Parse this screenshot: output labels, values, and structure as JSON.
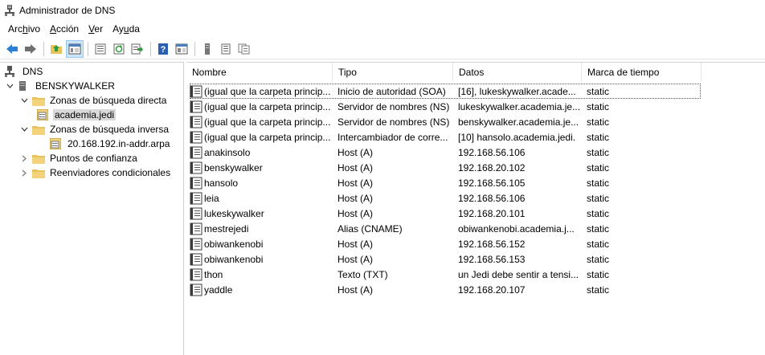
{
  "window": {
    "title": "Administrador de DNS"
  },
  "menubar": {
    "items": [
      {
        "pre": "Arc",
        "ul": "h",
        "post": "ivo"
      },
      {
        "pre": "",
        "ul": "A",
        "post": "cción"
      },
      {
        "pre": "",
        "ul": "V",
        "post": "er"
      },
      {
        "pre": "Ay",
        "ul": "u",
        "post": "da"
      }
    ]
  },
  "toolbar": {
    "buttons": [
      "back-icon",
      "forward-icon",
      "up-folder-icon",
      "show-tree-icon",
      "properties-icon",
      "refresh-icon",
      "export-list-icon",
      "help-icon",
      "console-view-icon",
      "server-icon",
      "zone-list-icon",
      "copy-records-icon"
    ]
  },
  "tree": {
    "root": "DNS",
    "server": "BENSKYWALKER",
    "forward_zones": "Zonas de búsqueda directa",
    "forward_zone_child": "academia.jedi",
    "reverse_zones": "Zonas de búsqueda inversa",
    "reverse_zone_child": "20.168.192.in-addr.arpa",
    "trust_points": "Puntos de confianza",
    "conditional_forwarders": "Reenviadores condicionales"
  },
  "list": {
    "columns": [
      "Nombre",
      "Tipo",
      "Datos",
      "Marca de tiempo"
    ],
    "rows": [
      {
        "name": "(igual que la carpeta princip...",
        "type": "Inicio de autoridad (SOA)",
        "data": "[16], lukeskywalker.acade...",
        "ts": "static"
      },
      {
        "name": "(igual que la carpeta princip...",
        "type": "Servidor de nombres (NS)",
        "data": "lukeskywalker.academia.je...",
        "ts": "static"
      },
      {
        "name": "(igual que la carpeta princip...",
        "type": "Servidor de nombres (NS)",
        "data": "benskywalker.academia.je...",
        "ts": "static"
      },
      {
        "name": "(igual que la carpeta princip...",
        "type": "Intercambiador de corre...",
        "data": "[10]  hansolo.academia.jedi.",
        "ts": "static"
      },
      {
        "name": "anakinsolo",
        "type": "Host (A)",
        "data": "192.168.56.106",
        "ts": "static"
      },
      {
        "name": "benskywalker",
        "type": "Host (A)",
        "data": "192.168.20.102",
        "ts": "static"
      },
      {
        "name": "hansolo",
        "type": "Host (A)",
        "data": "192.168.56.105",
        "ts": "static"
      },
      {
        "name": "leia",
        "type": "Host (A)",
        "data": "192.168.56.106",
        "ts": "static"
      },
      {
        "name": "lukeskywalker",
        "type": "Host (A)",
        "data": "192.168.20.101",
        "ts": "static"
      },
      {
        "name": "mestrejedi",
        "type": "Alias (CNAME)",
        "data": "obiwankenobi.academia.j...",
        "ts": "static"
      },
      {
        "name": "obiwankenobi",
        "type": "Host (A)",
        "data": "192.168.56.152",
        "ts": "static"
      },
      {
        "name": "obiwankenobi",
        "type": "Host (A)",
        "data": "192.168.56.153",
        "ts": "static"
      },
      {
        "name": "thon",
        "type": "Texto (TXT)",
        "data": "un Jedi debe sentir a tensi...",
        "ts": "static"
      },
      {
        "name": "yaddle",
        "type": "Host (A)",
        "data": "192.168.20.107",
        "ts": "static"
      }
    ]
  }
}
